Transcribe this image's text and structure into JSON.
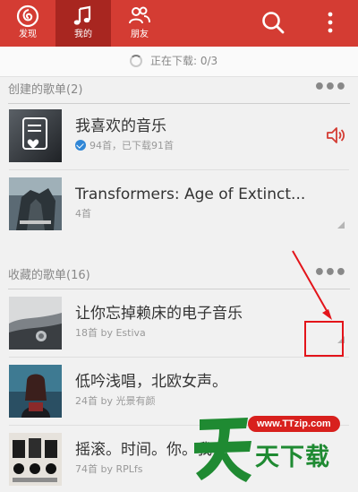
{
  "nav": {
    "tabs": [
      {
        "label": "发现",
        "icon": "netease-logo-icon"
      },
      {
        "label": "我的",
        "icon": "music-note-icon",
        "active": true
      },
      {
        "label": "朋友",
        "icon": "friends-icon"
      }
    ],
    "actions": [
      {
        "icon": "search-icon"
      },
      {
        "icon": "more-vertical-icon"
      }
    ]
  },
  "download": {
    "status": "正在下载: 0/3"
  },
  "created": {
    "header": "创建的歌单(2)",
    "items": [
      {
        "title": "我喜欢的音乐",
        "meta": "94首，已下载91首",
        "downloaded": true,
        "playing": true
      },
      {
        "title": "Transformers: Age of Extinct...",
        "meta": "4首"
      }
    ]
  },
  "collected": {
    "header": "收藏的歌单(16)",
    "items": [
      {
        "title": "让你忘掉赖床的电子音乐",
        "meta": "18首 by Estiva"
      },
      {
        "title": "低吟浅唱，北欧女声。",
        "meta": "24首 by 光景有颜"
      },
      {
        "title": "摇滚。时间。你。我",
        "meta": "74首 by RPLfs"
      }
    ]
  },
  "watermark": {
    "url": "www.TTzip.com",
    "name": "天下载"
  },
  "colors": {
    "brand_red": "#d43c33",
    "brand_red_dark": "#a82620",
    "annotation_red": "#e3141a",
    "check_blue": "#2f86d6"
  }
}
